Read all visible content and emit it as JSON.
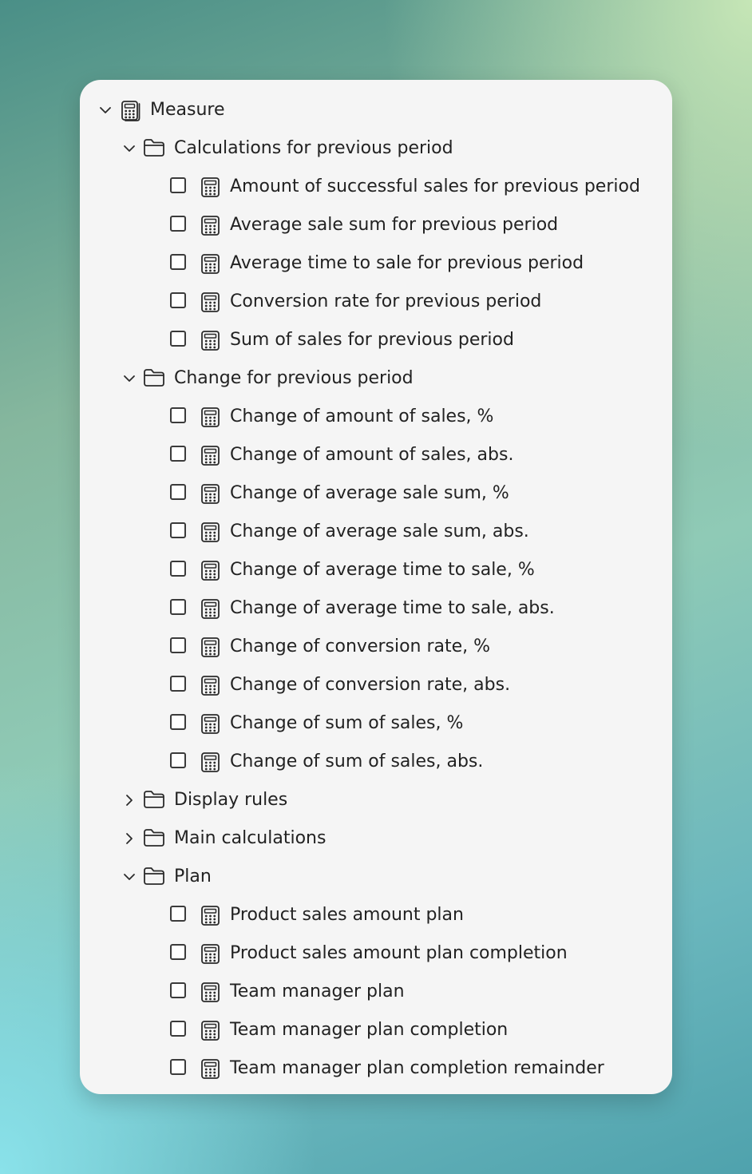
{
  "tree": {
    "root": {
      "label": "Measure",
      "icon": "calculator-stack-icon",
      "expanded": true,
      "children": [
        {
          "label": "Calculations for previous period",
          "icon": "folder-icon",
          "expanded": true,
          "items": [
            "Amount of successful sales for previous period",
            "Average sale sum for previous period",
            "Average time to sale for previous period",
            "Conversion rate for previous period",
            "Sum of sales for previous period"
          ]
        },
        {
          "label": "Change for previous period",
          "icon": "folder-icon",
          "expanded": true,
          "items": [
            "Change of amount of sales, %",
            "Change of amount of sales, abs.",
            "Change of average sale sum, %",
            "Change of average sale sum, abs.",
            "Change of average time to sale, %",
            "Change of average time to sale, abs.",
            "Change of conversion rate, %",
            "Change of conversion rate, abs.",
            "Change of sum of sales, %",
            "Change of sum of sales, abs."
          ]
        },
        {
          "label": "Display rules",
          "icon": "folder-icon",
          "expanded": false,
          "items": []
        },
        {
          "label": "Main calculations",
          "icon": "folder-icon",
          "expanded": false,
          "items": []
        },
        {
          "label": "Plan",
          "icon": "folder-icon",
          "expanded": true,
          "items": [
            "Product sales amount plan",
            "Product sales amount plan completion",
            "Team manager plan",
            "Team manager plan completion",
            "Team manager plan completion remainder"
          ]
        }
      ]
    },
    "item_icon": "calculator-icon",
    "colors": {
      "panel": "#f5f5f5",
      "text": "#222222",
      "icon": "#2b2b2b"
    }
  }
}
